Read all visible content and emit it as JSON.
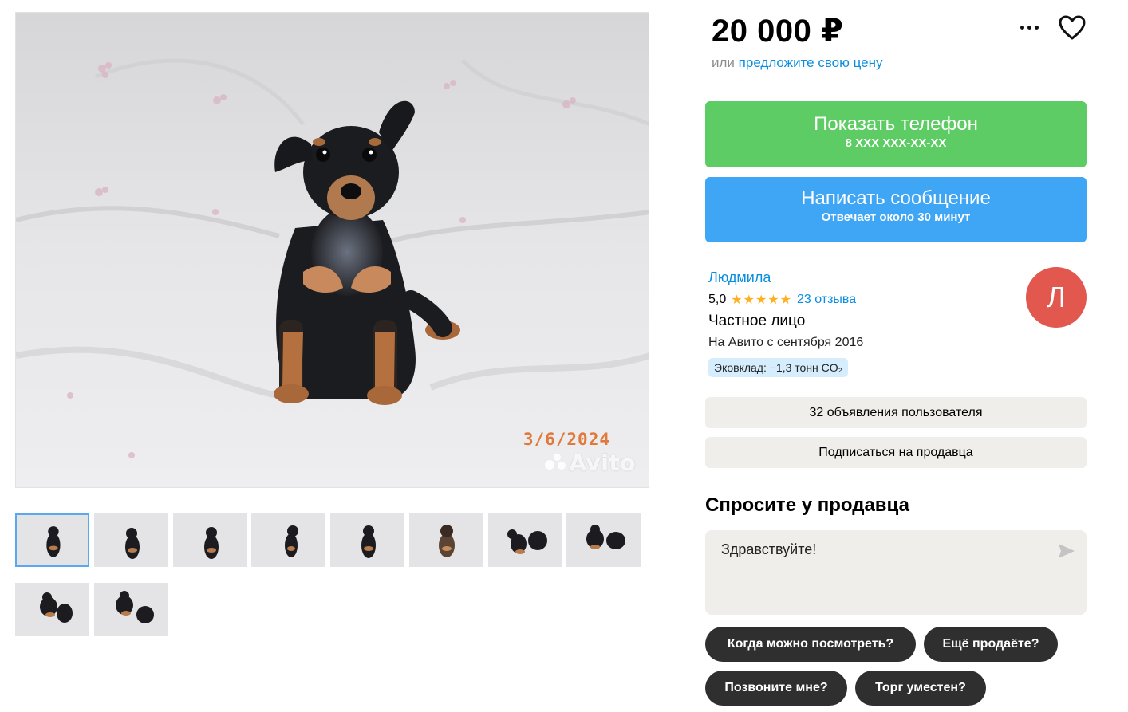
{
  "listing": {
    "photo_date": "3/6/2024",
    "watermark": "Avito",
    "thumbnail_count": 10
  },
  "price": {
    "value": "20 000 ₽",
    "or_text": "или",
    "offer_link": "предложите свою цену"
  },
  "actions": {
    "more_icon": "more-dots-icon",
    "favorite_icon": "heart-icon"
  },
  "contact": {
    "phone_label": "Показать телефон",
    "phone_mask": "8 XXX XXX-XX-XX",
    "message_label": "Написать сообщение",
    "message_sub": "Отвечает около 30 минут"
  },
  "seller": {
    "name": "Людмила",
    "rating": "5,0",
    "stars": "★★★★★",
    "reviews": "23 отзыва",
    "type": "Частное лицо",
    "since": "На Авито с сентября 2016",
    "eco": "Эковклад: −1,3 тонн CO₂",
    "avatar_letter": "Л",
    "avatar_color": "#e2584e"
  },
  "seller_buttons": {
    "listings": "32 объявления пользователя",
    "subscribe": "Подписаться на продавца"
  },
  "ask": {
    "title": "Спросите у продавца",
    "message_value": "Здравствуйте!",
    "send_icon": "send-icon",
    "quick_questions": [
      "Когда можно посмотреть?",
      "Ещё продаёте?",
      "Позвоните мне?",
      "Торг уместен?"
    ]
  },
  "colors": {
    "green": "#5dcc64",
    "blue": "#3fa5f5",
    "link": "#0a8ee0",
    "star": "#ffb021"
  }
}
